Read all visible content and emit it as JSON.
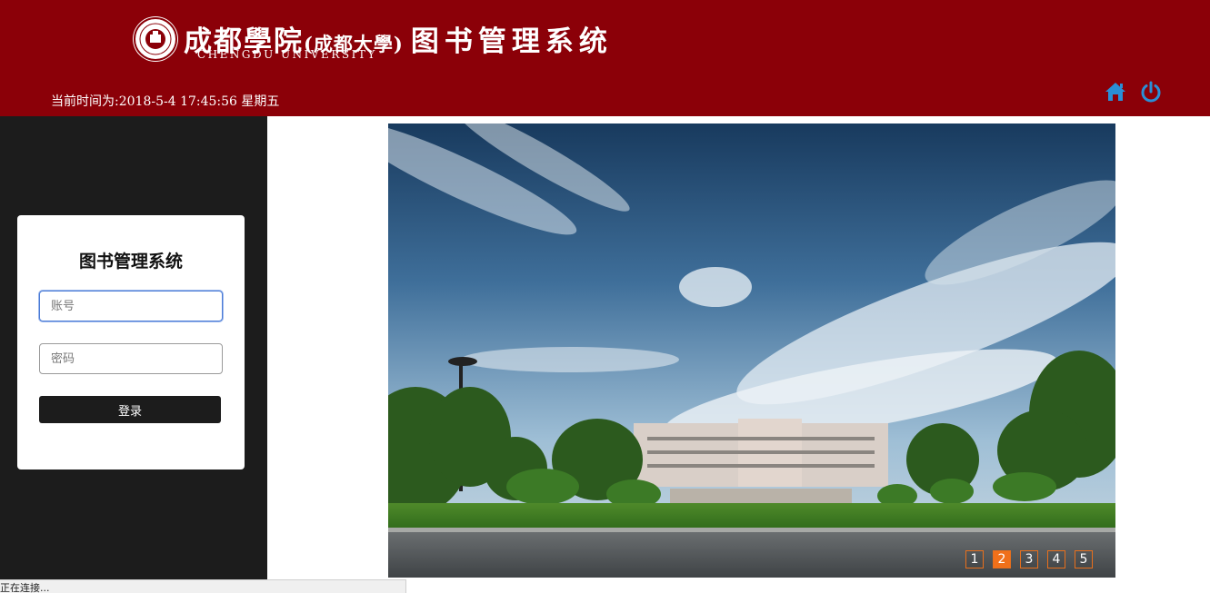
{
  "header": {
    "title_cn": "成都學院",
    "title_paren": "(成都大學)",
    "title_sys": "图书管理系统",
    "title_en": "CHENGDU UNIVERSITY",
    "clock_prefix": "当前时间为:",
    "clock_value": "2018-5-4 17:45:56 星期五",
    "icons": {
      "home": "home-icon",
      "power": "power-icon"
    },
    "colors": {
      "background": "#8b0008",
      "icon": "#2a8fd6"
    }
  },
  "sidebar": {
    "background": "#1c1c1c",
    "login": {
      "title": "图书管理系统",
      "account_placeholder": "账号",
      "password_placeholder": "密码",
      "submit_label": "登录"
    }
  },
  "slider": {
    "pages": [
      "1",
      "2",
      "3",
      "4",
      "5"
    ],
    "active_page": "2",
    "accent": "#f0701a"
  },
  "status_bar": {
    "text": "正在连接..."
  }
}
